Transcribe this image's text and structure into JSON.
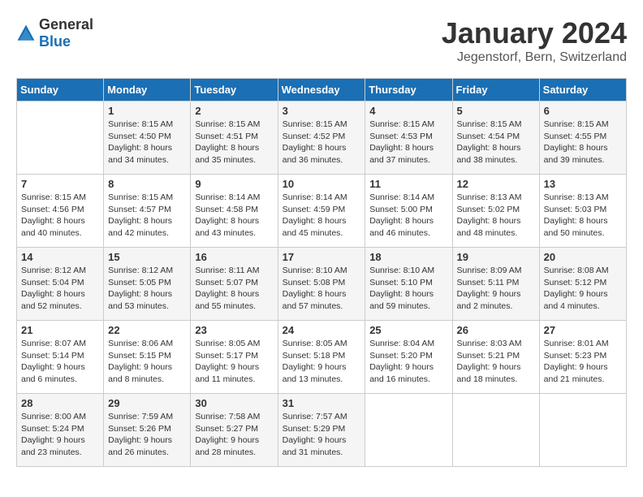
{
  "header": {
    "logo_general": "General",
    "logo_blue": "Blue",
    "month": "January 2024",
    "location": "Jegenstorf, Bern, Switzerland"
  },
  "weekdays": [
    "Sunday",
    "Monday",
    "Tuesday",
    "Wednesday",
    "Thursday",
    "Friday",
    "Saturday"
  ],
  "weeks": [
    [
      {
        "day": "",
        "sunrise": "",
        "sunset": "",
        "daylight": ""
      },
      {
        "day": "1",
        "sunrise": "Sunrise: 8:15 AM",
        "sunset": "Sunset: 4:50 PM",
        "daylight": "Daylight: 8 hours and 34 minutes."
      },
      {
        "day": "2",
        "sunrise": "Sunrise: 8:15 AM",
        "sunset": "Sunset: 4:51 PM",
        "daylight": "Daylight: 8 hours and 35 minutes."
      },
      {
        "day": "3",
        "sunrise": "Sunrise: 8:15 AM",
        "sunset": "Sunset: 4:52 PM",
        "daylight": "Daylight: 8 hours and 36 minutes."
      },
      {
        "day": "4",
        "sunrise": "Sunrise: 8:15 AM",
        "sunset": "Sunset: 4:53 PM",
        "daylight": "Daylight: 8 hours and 37 minutes."
      },
      {
        "day": "5",
        "sunrise": "Sunrise: 8:15 AM",
        "sunset": "Sunset: 4:54 PM",
        "daylight": "Daylight: 8 hours and 38 minutes."
      },
      {
        "day": "6",
        "sunrise": "Sunrise: 8:15 AM",
        "sunset": "Sunset: 4:55 PM",
        "daylight": "Daylight: 8 hours and 39 minutes."
      }
    ],
    [
      {
        "day": "7",
        "sunrise": "Sunrise: 8:15 AM",
        "sunset": "Sunset: 4:56 PM",
        "daylight": "Daylight: 8 hours and 40 minutes."
      },
      {
        "day": "8",
        "sunrise": "Sunrise: 8:15 AM",
        "sunset": "Sunset: 4:57 PM",
        "daylight": "Daylight: 8 hours and 42 minutes."
      },
      {
        "day": "9",
        "sunrise": "Sunrise: 8:14 AM",
        "sunset": "Sunset: 4:58 PM",
        "daylight": "Daylight: 8 hours and 43 minutes."
      },
      {
        "day": "10",
        "sunrise": "Sunrise: 8:14 AM",
        "sunset": "Sunset: 4:59 PM",
        "daylight": "Daylight: 8 hours and 45 minutes."
      },
      {
        "day": "11",
        "sunrise": "Sunrise: 8:14 AM",
        "sunset": "Sunset: 5:00 PM",
        "daylight": "Daylight: 8 hours and 46 minutes."
      },
      {
        "day": "12",
        "sunrise": "Sunrise: 8:13 AM",
        "sunset": "Sunset: 5:02 PM",
        "daylight": "Daylight: 8 hours and 48 minutes."
      },
      {
        "day": "13",
        "sunrise": "Sunrise: 8:13 AM",
        "sunset": "Sunset: 5:03 PM",
        "daylight": "Daylight: 8 hours and 50 minutes."
      }
    ],
    [
      {
        "day": "14",
        "sunrise": "Sunrise: 8:12 AM",
        "sunset": "Sunset: 5:04 PM",
        "daylight": "Daylight: 8 hours and 52 minutes."
      },
      {
        "day": "15",
        "sunrise": "Sunrise: 8:12 AM",
        "sunset": "Sunset: 5:05 PM",
        "daylight": "Daylight: 8 hours and 53 minutes."
      },
      {
        "day": "16",
        "sunrise": "Sunrise: 8:11 AM",
        "sunset": "Sunset: 5:07 PM",
        "daylight": "Daylight: 8 hours and 55 minutes."
      },
      {
        "day": "17",
        "sunrise": "Sunrise: 8:10 AM",
        "sunset": "Sunset: 5:08 PM",
        "daylight": "Daylight: 8 hours and 57 minutes."
      },
      {
        "day": "18",
        "sunrise": "Sunrise: 8:10 AM",
        "sunset": "Sunset: 5:10 PM",
        "daylight": "Daylight: 8 hours and 59 minutes."
      },
      {
        "day": "19",
        "sunrise": "Sunrise: 8:09 AM",
        "sunset": "Sunset: 5:11 PM",
        "daylight": "Daylight: 9 hours and 2 minutes."
      },
      {
        "day": "20",
        "sunrise": "Sunrise: 8:08 AM",
        "sunset": "Sunset: 5:12 PM",
        "daylight": "Daylight: 9 hours and 4 minutes."
      }
    ],
    [
      {
        "day": "21",
        "sunrise": "Sunrise: 8:07 AM",
        "sunset": "Sunset: 5:14 PM",
        "daylight": "Daylight: 9 hours and 6 minutes."
      },
      {
        "day": "22",
        "sunrise": "Sunrise: 8:06 AM",
        "sunset": "Sunset: 5:15 PM",
        "daylight": "Daylight: 9 hours and 8 minutes."
      },
      {
        "day": "23",
        "sunrise": "Sunrise: 8:05 AM",
        "sunset": "Sunset: 5:17 PM",
        "daylight": "Daylight: 9 hours and 11 minutes."
      },
      {
        "day": "24",
        "sunrise": "Sunrise: 8:05 AM",
        "sunset": "Sunset: 5:18 PM",
        "daylight": "Daylight: 9 hours and 13 minutes."
      },
      {
        "day": "25",
        "sunrise": "Sunrise: 8:04 AM",
        "sunset": "Sunset: 5:20 PM",
        "daylight": "Daylight: 9 hours and 16 minutes."
      },
      {
        "day": "26",
        "sunrise": "Sunrise: 8:03 AM",
        "sunset": "Sunset: 5:21 PM",
        "daylight": "Daylight: 9 hours and 18 minutes."
      },
      {
        "day": "27",
        "sunrise": "Sunrise: 8:01 AM",
        "sunset": "Sunset: 5:23 PM",
        "daylight": "Daylight: 9 hours and 21 minutes."
      }
    ],
    [
      {
        "day": "28",
        "sunrise": "Sunrise: 8:00 AM",
        "sunset": "Sunset: 5:24 PM",
        "daylight": "Daylight: 9 hours and 23 minutes."
      },
      {
        "day": "29",
        "sunrise": "Sunrise: 7:59 AM",
        "sunset": "Sunset: 5:26 PM",
        "daylight": "Daylight: 9 hours and 26 minutes."
      },
      {
        "day": "30",
        "sunrise": "Sunrise: 7:58 AM",
        "sunset": "Sunset: 5:27 PM",
        "daylight": "Daylight: 9 hours and 28 minutes."
      },
      {
        "day": "31",
        "sunrise": "Sunrise: 7:57 AM",
        "sunset": "Sunset: 5:29 PM",
        "daylight": "Daylight: 9 hours and 31 minutes."
      },
      {
        "day": "",
        "sunrise": "",
        "sunset": "",
        "daylight": ""
      },
      {
        "day": "",
        "sunrise": "",
        "sunset": "",
        "daylight": ""
      },
      {
        "day": "",
        "sunrise": "",
        "sunset": "",
        "daylight": ""
      }
    ]
  ]
}
